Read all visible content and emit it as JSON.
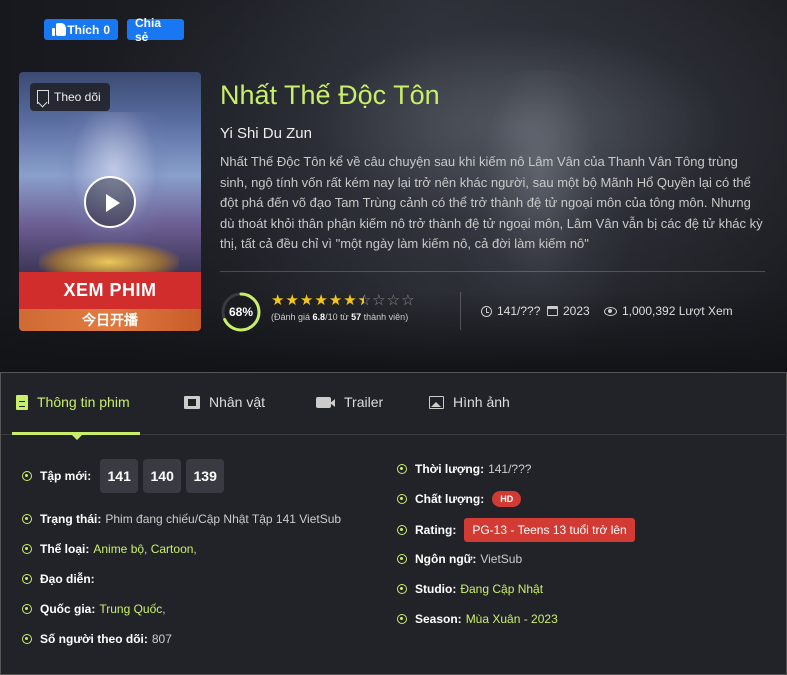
{
  "social": {
    "like_label": "Thích",
    "like_count": "0",
    "share_label": "Chia sẻ"
  },
  "poster": {
    "follow_label": "Theo dõi",
    "watch_label": "XEM PHIM",
    "bottom_text": "今日开播"
  },
  "movie": {
    "title": "Nhất Thế Độc Tôn",
    "original_title": "Yi Shi Du Zun",
    "description": "Nhất Thế Độc Tôn kể về câu chuyện sau khi kiếm nô Lâm Vân của Thanh Vân Tông trùng sinh, ngộ tính vốn rất kém nay lại trở nên khác người, sau một bộ Mãnh Hổ Quyền lại có thể đột phá đến võ đạo Tam Trùng cảnh có thể trở thành đệ tử ngoại môn của tông môn. Nhưng dù thoát khỏi thân phận kiếm nô trở thành đệ tử ngoại môn, Lâm Vân vẫn bị các đệ tử khác kỳ thị, tất cả đều chỉ vì \"một ngày làm kiếm nô, cả đời làm kiếm nô\"",
    "score_percent": "68%",
    "score_fraction": 0.68,
    "stars_value": 6.8,
    "stars_max": 10,
    "rating_prefix": "(Đánh giá",
    "rating_value": "6.8",
    "rating_mid": "/10 từ",
    "rating_votes": "57",
    "rating_suffix": "thành viên)",
    "episodes": "141/???",
    "year": "2023",
    "views": "1,000,392 Lượt Xem"
  },
  "tabs": [
    {
      "label": "Thông tin phim",
      "icon": "document-icon",
      "active": true
    },
    {
      "label": "Nhân vật",
      "icon": "film-icon",
      "active": false
    },
    {
      "label": "Trailer",
      "icon": "video-icon",
      "active": false
    },
    {
      "label": "Hình ảnh",
      "icon": "image-icon",
      "active": false
    }
  ],
  "details_left": {
    "latest_label": "Tập mới:",
    "latest_episodes": [
      "141",
      "140",
      "139"
    ],
    "status_label": "Trạng thái:",
    "status_value": "Phim đang chiếu/Cập Nhật Tập 141 VietSub",
    "genre_label": "Thể loại:",
    "genres": [
      "Anime bộ",
      "Cartoon"
    ],
    "director_label": "Đạo diễn:",
    "country_label": "Quốc gia:",
    "country_value": "Trung Quốc",
    "followers_label": "Số người theo dõi:",
    "followers_value": "807"
  },
  "details_right": {
    "duration_label": "Thời lượng:",
    "duration_value": "141/???",
    "quality_label": "Chất lượng:",
    "quality_value": "HD",
    "rating_label": "Rating:",
    "rating_value": "PG-13 - Teens 13 tuổi trở lên",
    "language_label": "Ngôn ngữ:",
    "language_value": "VietSub",
    "studio_label": "Studio:",
    "studio_value": "Đang Cập Nhật",
    "season_label": "Season:",
    "season_value": "Mùa Xuân - 2023"
  },
  "colors": {
    "accent": "#c9ef6a",
    "badge_red": "#d23a34",
    "facebook_blue": "#1877f2",
    "star": "#f5c518"
  }
}
